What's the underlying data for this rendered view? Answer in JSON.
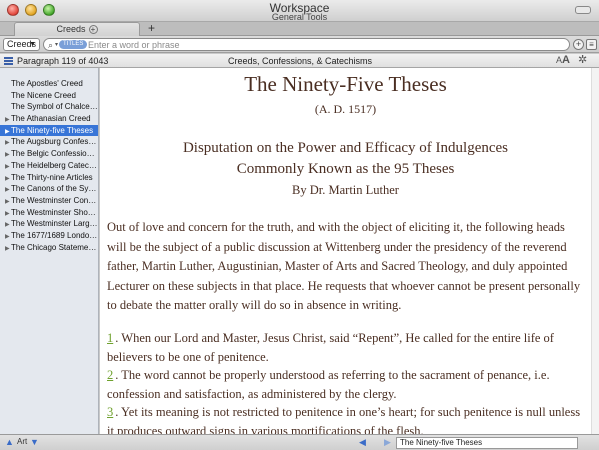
{
  "window": {
    "title": "Workspace",
    "subtitle": "General Tools"
  },
  "tabs": [
    {
      "label": "Creeds"
    }
  ],
  "new_tab_icon": "plus-icon",
  "toolbar": {
    "resource": "Creeds",
    "search_scope": "TITLES",
    "search_placeholder": "Enter a word or phrase"
  },
  "header": {
    "paragraph_info": "Paragraph 119 of 4043",
    "doc_title": "Creeds, Confessions, & Catechisms",
    "font_small": "A",
    "font_large": "A"
  },
  "sidebar": {
    "items": [
      {
        "label": "The Apostles' Creed",
        "disclosure": ""
      },
      {
        "label": "The Nicene Creed",
        "disclosure": ""
      },
      {
        "label": "The Symbol of Chalcedon",
        "disclosure": ""
      },
      {
        "label": "The Athanasian Creed",
        "disclosure": "▶"
      },
      {
        "label": "The Ninety-five Theses",
        "disclosure": "▶",
        "selected": true
      },
      {
        "label": "The Augsburg Confession",
        "disclosure": "▶"
      },
      {
        "label": "The Belgic Confession o...",
        "disclosure": "▶"
      },
      {
        "label": "The Heidelberg Catechism",
        "disclosure": "▶"
      },
      {
        "label": "The Thirty-nine Articles",
        "disclosure": "▶"
      },
      {
        "label": "The Canons of the Syno...",
        "disclosure": "▶"
      },
      {
        "label": "The Westminster Confe...",
        "disclosure": "▶"
      },
      {
        "label": "The Westminster Shorte...",
        "disclosure": "▶"
      },
      {
        "label": "The Westminster Larger...",
        "disclosure": "▶"
      },
      {
        "label": "The 1677/1689 London...",
        "disclosure": "▶"
      },
      {
        "label": "The Chicago Statement...",
        "disclosure": "▶"
      }
    ]
  },
  "document": {
    "heading": "The Ninety-Five Theses",
    "date": "(A. D. 1517)",
    "subtitle_line1": "Disputation on the Power and Efficacy of Indulgences",
    "subtitle_line2": "Commonly Known as the 95 Theses",
    "author": "By Dr. Martin Luther",
    "intro": "Out of love and concern for the truth, and with the object of eliciting it, the following heads will be the subject of a public discussion at Wittenberg under the presidency of the reverend father, Martin Luther, Augustinian, Master of Arts and Sacred Theology, and duly appointed Lecturer on these subjects in that place. He requests that whoever cannot be present personally to debate the matter orally will do so in absence in writing.",
    "theses": [
      {
        "number": "1",
        "text": ". When our Lord and Master, Jesus Christ, said “Repent”, He called for the entire life of believers to be one of penitence."
      },
      {
        "number": "2",
        "text": ". The word cannot be properly understood as referring to the sacrament of penance, i.e. confession and satisfaction, as administered by the clergy."
      },
      {
        "number": "3",
        "text": ". Yet its meaning is not restricted to penitence in one’s heart; for such penitence is null unless it produces outward signs in various mortifications of the flesh."
      }
    ]
  },
  "statusbar": {
    "filter_label": "Art",
    "location": "The Ninety-five Theses"
  },
  "colors": {
    "selection": "#3875d7",
    "thesis_number": "#6fa12e",
    "body_text": "#4a2e22"
  }
}
